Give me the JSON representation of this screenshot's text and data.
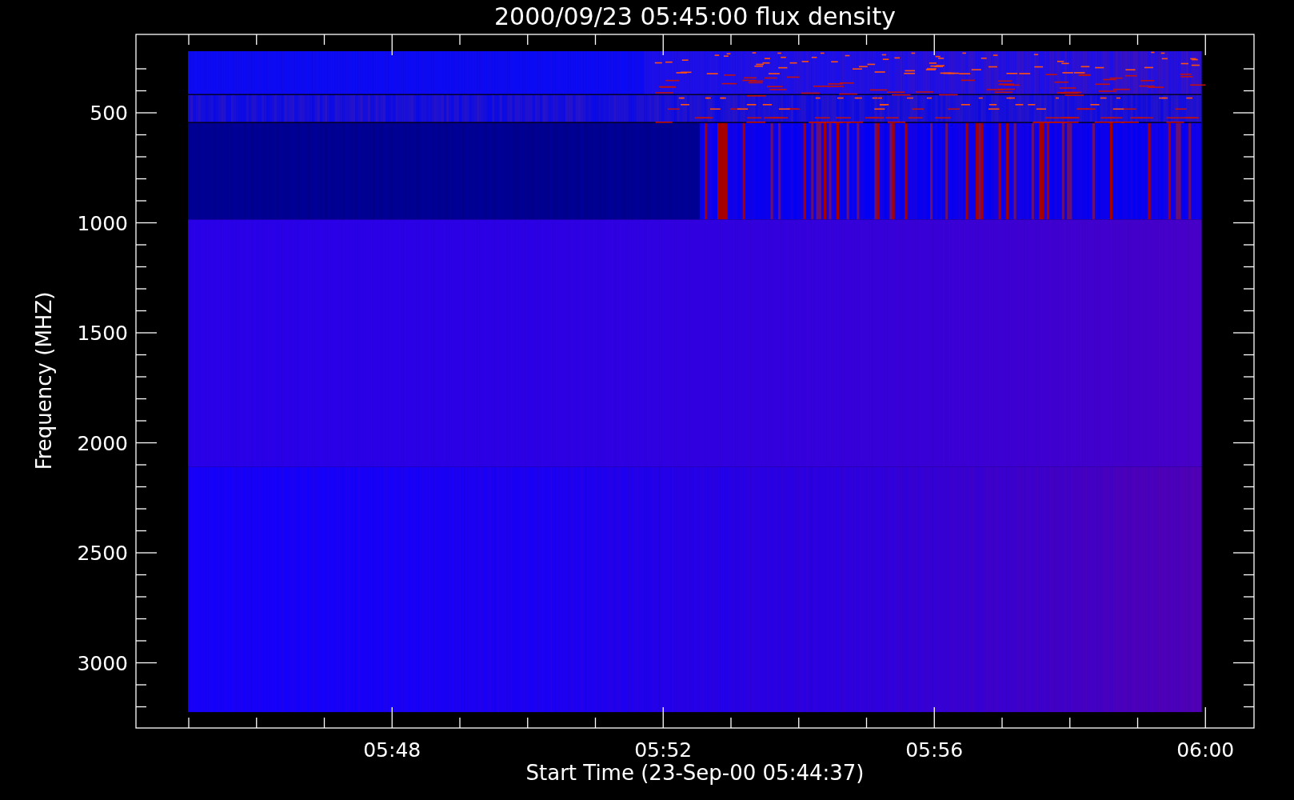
{
  "title": "2000/09/23 05:45:00 flux density",
  "y_axis": {
    "label": "Frequency (MHZ)",
    "ticks": [
      "500",
      "1000",
      "1500",
      "2000",
      "2500",
      "3000"
    ]
  },
  "x_axis": {
    "label": "Start Time (23-Sep-00 05:44:37)",
    "ticks": [
      "05:48",
      "05:52",
      "05:56",
      "06:00"
    ]
  }
}
